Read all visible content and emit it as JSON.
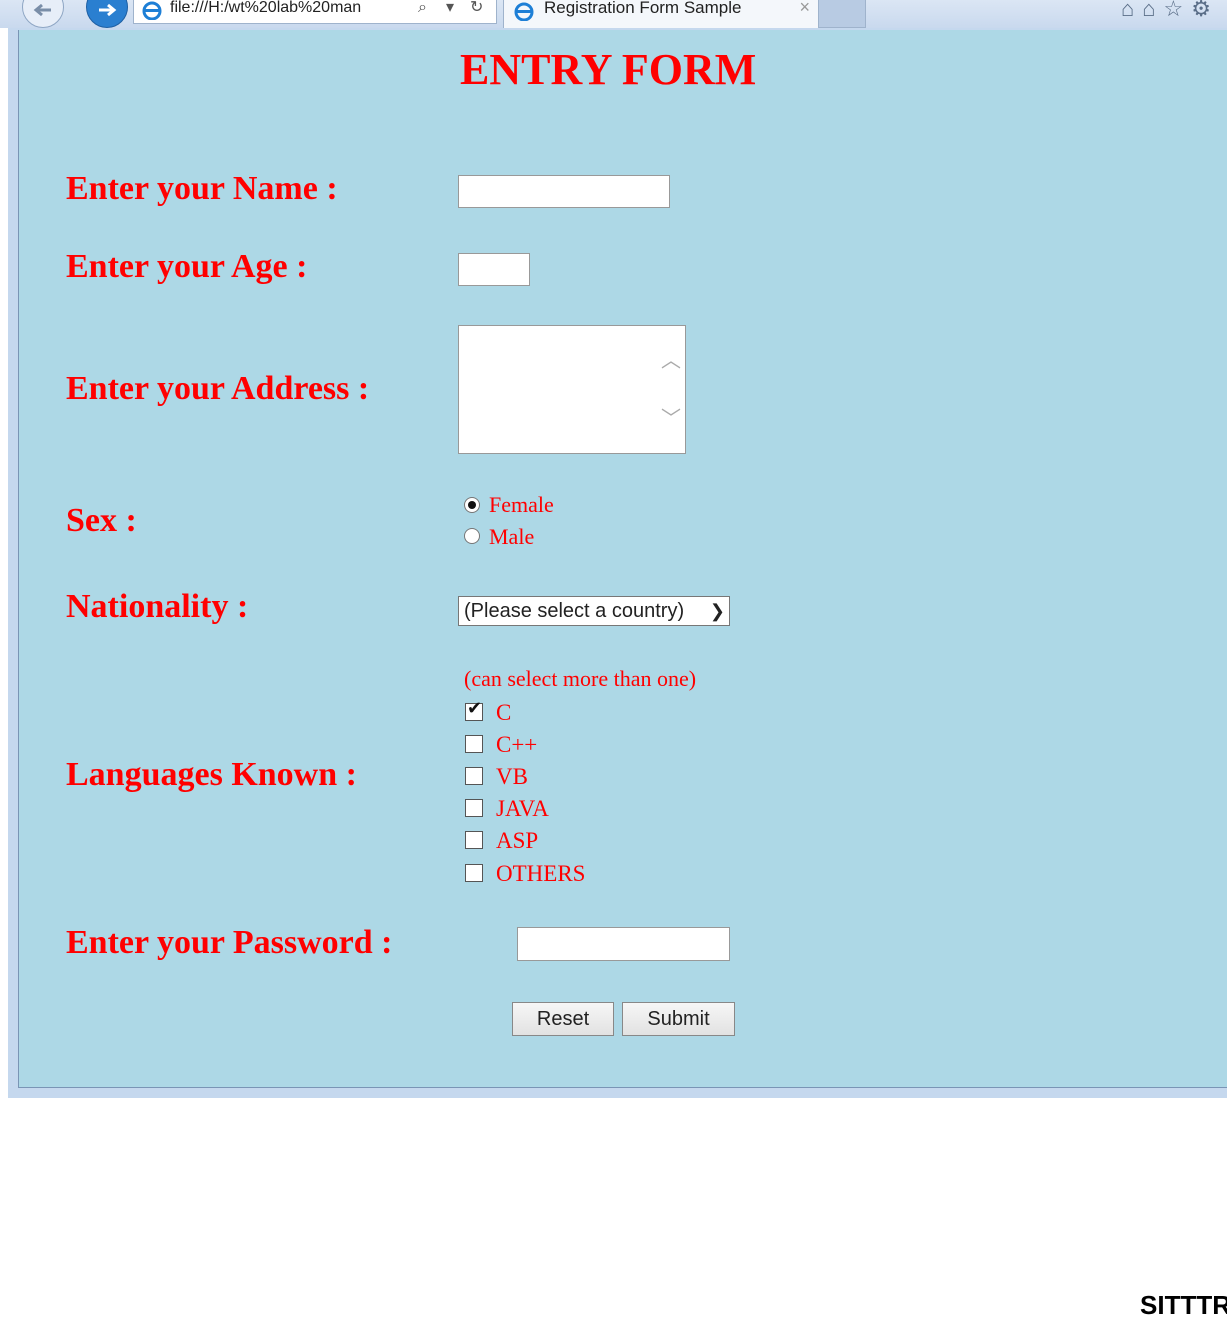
{
  "browser": {
    "address": "file:///H:/wt%20lab%20man",
    "tab_title": "Registration Form Sample",
    "tab_close": "×"
  },
  "form": {
    "heading": "ENTRY FORM",
    "name_label": "Enter your Name :",
    "name_value": "",
    "age_label": "Enter your Age :",
    "age_value": "",
    "address_label": "Enter your Address :",
    "address_value": "",
    "sex_label": "Sex :",
    "sex_options": [
      "Female",
      "Male"
    ],
    "sex_selected": "Female",
    "nationality_label": "Nationality :",
    "nationality_selected": "(Please select a country)",
    "languages_label": "Languages Known :",
    "languages_hint": "(can select more than one)",
    "languages": [
      {
        "label": "C",
        "checked": true
      },
      {
        "label": "C++",
        "checked": false
      },
      {
        "label": "VB",
        "checked": false
      },
      {
        "label": "JAVA",
        "checked": false
      },
      {
        "label": "ASP",
        "checked": false
      },
      {
        "label": "OTHERS",
        "checked": false
      }
    ],
    "password_label": "Enter your Password :",
    "password_value": "",
    "reset_label": "Reset",
    "submit_label": "Submit",
    "accent_color": "#ff0000",
    "background_color": "#add8e6"
  },
  "footer_text": "SITTTR"
}
